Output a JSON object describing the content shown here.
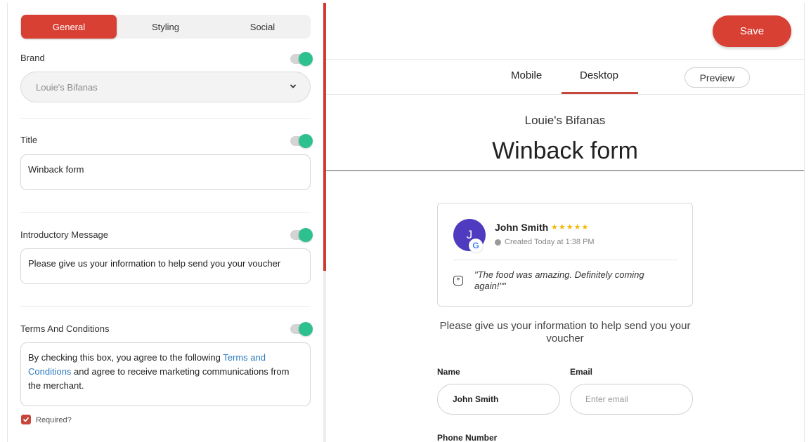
{
  "tabs": {
    "general": "General",
    "styling": "Styling",
    "social": "Social"
  },
  "brand": {
    "label": "Brand",
    "selected": "Louie's Bifanas"
  },
  "title_section": {
    "label": "Title",
    "value": "Winback form"
  },
  "intro_section": {
    "label": "Introductory Message",
    "value": "Please give us your information to help send you your voucher"
  },
  "terms_section": {
    "label": "Terms And Conditions",
    "text_before": "By checking this box, you agree to the following ",
    "link_text": "Terms and Conditions",
    "text_after": " and agree to receive marketing communications from the merchant."
  },
  "required": {
    "label": "Required?",
    "checked": true
  },
  "toolbar": {
    "save_label": "Save"
  },
  "view_tabs": {
    "mobile": "Mobile",
    "desktop": "Desktop",
    "preview": "Preview"
  },
  "preview": {
    "brand_name": "Louie's Bifanas",
    "form_title": "Winback form",
    "review": {
      "avatar_initial": "J",
      "reviewer_name": "John Smith",
      "stars": "★★★★★",
      "rating": 5,
      "created": "Created Today at 1:38 PM",
      "quote": "\"The food was amazing. Definitely coming again!\"\""
    },
    "intro": "Please give us your information to help send you your voucher",
    "fields": {
      "name_label": "Name",
      "name_value": "John Smith",
      "email_label": "Email",
      "email_placeholder": "Enter email",
      "phone_label": "Phone Number"
    }
  },
  "colors": {
    "accent": "#d94034",
    "toggle_on": "#2fc08f",
    "link": "#2b7bbf",
    "avatar": "#4e3bbf",
    "star": "#f2b705"
  },
  "icons": {
    "select_caret": "chevron-down-icon",
    "google_badge": "google-icon",
    "quote": "quote-icon",
    "clock": "clock-icon",
    "checkbox": "check-icon"
  }
}
